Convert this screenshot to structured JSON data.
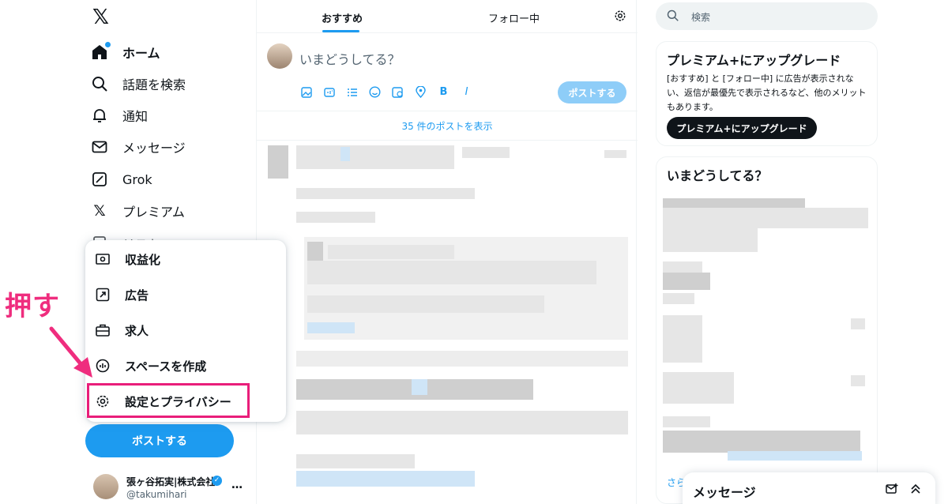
{
  "sidebar": {
    "nav": [
      {
        "label": "ホーム",
        "icon": "home-icon"
      },
      {
        "label": "話題を検索",
        "icon": "search-icon"
      },
      {
        "label": "通知",
        "icon": "bell-icon"
      },
      {
        "label": "メッセージ",
        "icon": "mail-icon"
      },
      {
        "label": "Grok",
        "icon": "grok-icon"
      },
      {
        "label": "プレミアム",
        "icon": "x-logo-icon"
      },
      {
        "label": "リスト",
        "icon": "list-icon"
      }
    ],
    "post_button": "ポストする",
    "profile": {
      "name": "張ヶ谷拓実|株式会社",
      "handle": "@takumihari",
      "more": "…"
    }
  },
  "popup_menu": {
    "items": [
      {
        "label": "収益化",
        "icon": "money-icon"
      },
      {
        "label": "広告",
        "icon": "ads-icon"
      },
      {
        "label": "求人",
        "icon": "briefcase-icon"
      },
      {
        "label": "スペースを作成",
        "icon": "spaces-icon"
      },
      {
        "label": "設定とプライバシー",
        "icon": "gear-icon"
      }
    ]
  },
  "annotation": {
    "text": "押す",
    "color": "#ef2d7e"
  },
  "main": {
    "tabs": [
      {
        "label": "おすすめ"
      },
      {
        "label": "フォロー中"
      }
    ],
    "composer": {
      "placeholder": "いまどうしてる？",
      "post_button": "ポストする"
    },
    "show_posts": "35 件のポストを表示"
  },
  "right": {
    "search_placeholder": "検索",
    "premium": {
      "title": "プレミアム+にアップグレード",
      "description": "[おすすめ] と [フォロー中] に広告が表示されない、返信が最優先で表示されるなど、他のメリットもあります。",
      "button": "プレミアム+にアップグレード"
    },
    "trends": {
      "title": "いまどうしてる？",
      "more": "さら"
    }
  },
  "messages_drawer": {
    "title": "メッセージ"
  },
  "colors": {
    "accent": "#1d9bf0",
    "highlight": "#e91e7a"
  }
}
